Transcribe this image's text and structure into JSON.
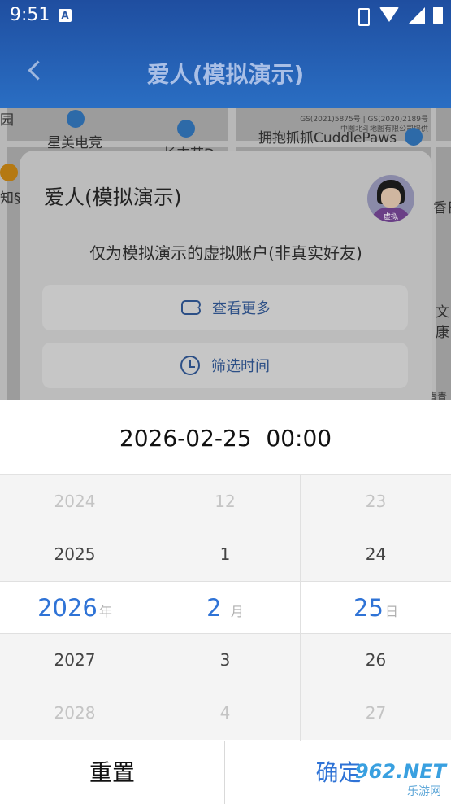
{
  "status_bar": {
    "time": "9:51",
    "badge": "A"
  },
  "nav": {
    "title": "爱人(模拟演示)"
  },
  "map": {
    "copyright": "GS(2021)5875号 | GS(2020)2189号",
    "copyright2": "中图北斗地图有限公司提供",
    "pois": [
      "园",
      "星美电竞",
      "长丰苑D",
      "拥抱抓抓CuddlePaws",
      "知§",
      "香日",
      "文康",
      "青青"
    ]
  },
  "card": {
    "name": "爱人(模拟演示)",
    "avatar_tag": "虚拟",
    "description": "仅为模拟演示的虚拟账户(非真实好友)",
    "more_label": "查看更多",
    "filter_label": "筛选时间"
  },
  "picker": {
    "selected_display": "2026-02-25  00:00",
    "year": {
      "rows": [
        "2024",
        "2025",
        "2026",
        "2027",
        "2028"
      ],
      "unit": "年"
    },
    "month": {
      "rows": [
        "12",
        "1",
        "2",
        "3",
        "4"
      ],
      "unit": "月"
    },
    "day": {
      "rows": [
        "23",
        "24",
        "25",
        "26",
        "27"
      ],
      "unit": "日"
    },
    "reset_label": "重置",
    "confirm_label": "确定"
  },
  "watermark": {
    "line1": "962.NET",
    "line2": "乐游网"
  },
  "colors": {
    "accent": "#2f73d6",
    "header": "#1f4ea0"
  }
}
